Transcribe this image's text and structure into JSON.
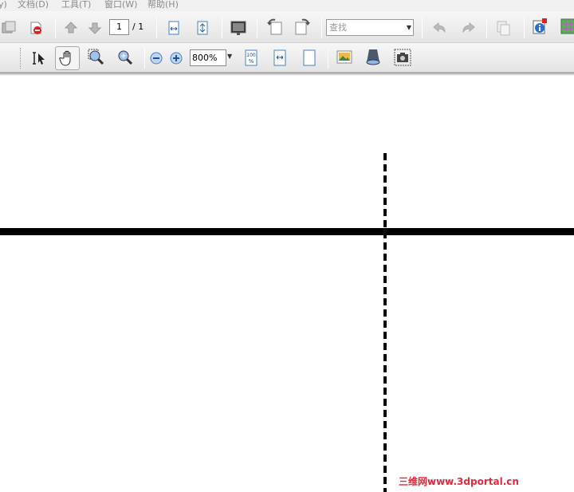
{
  "menu": {
    "items": [
      "y)",
      "文档(D)",
      "工具(T)",
      "窗口(W)",
      "帮助(H)"
    ]
  },
  "toolbar1": {
    "page_current": "1",
    "page_total": "/ 1",
    "find_placeholder": "查找",
    "icons": [
      "clone-icon",
      "security-icon",
      "previous-page-icon",
      "next-page-icon",
      "fit-width-icon",
      "fit-page-icon",
      "full-screen-icon",
      "rotate-left-icon",
      "rotate-right-icon",
      "undo-icon",
      "redo-icon",
      "copy-icon",
      "info-icon",
      "grid-icon"
    ]
  },
  "toolbar2": {
    "zoom_value": "800%",
    "icons": [
      "text-select-icon",
      "hand-icon",
      "marquee-zoom-icon",
      "dynamic-zoom-icon",
      "zoom-out-icon",
      "zoom-in-icon",
      "actual-size-icon",
      "fit-width-icon",
      "fit-page-icon",
      "picture-icon",
      "loupe-icon",
      "snapshot-icon"
    ]
  },
  "watermark": "三维网www.3dportal.cn"
}
